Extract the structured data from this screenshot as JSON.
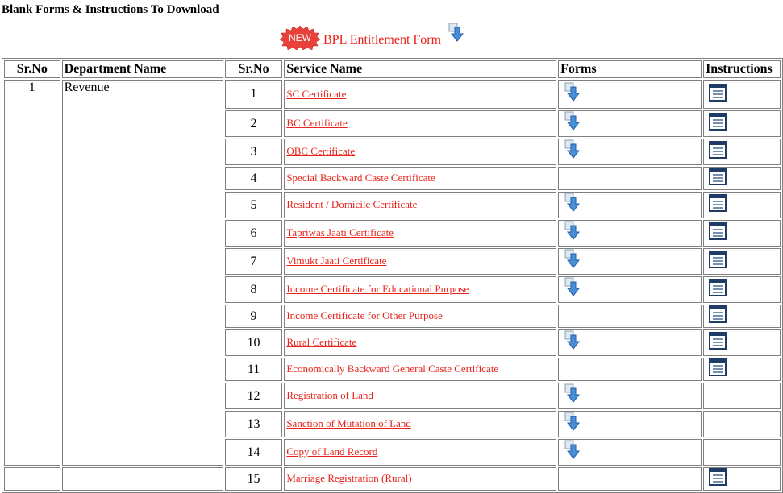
{
  "page": {
    "title": "Blank Forms & Instructions To Download"
  },
  "bpl": {
    "badge": "NEW",
    "link_label": "BPL Entitlement Form",
    "download_icon": "download-arrow-icon"
  },
  "table": {
    "headers": {
      "sr_no": "Sr.No",
      "department": "Department Name",
      "sr_no2": "Sr.No",
      "service": "Service Name",
      "forms": "Forms",
      "instructions": "Instructions"
    },
    "department": {
      "sr_no": "1",
      "name": "Revenue"
    },
    "rows": [
      {
        "sr": "1",
        "service": "SC Certificate",
        "linked": true,
        "form": true,
        "instr": true
      },
      {
        "sr": "2",
        "service": "BC Certificate",
        "linked": true,
        "form": true,
        "instr": true
      },
      {
        "sr": "3",
        "service": "OBC Certificate",
        "linked": true,
        "form": true,
        "instr": true
      },
      {
        "sr": "4",
        "service": "Special Backward Caste Certificate",
        "linked": false,
        "form": false,
        "instr": true
      },
      {
        "sr": "5",
        "service": "Resident / Domicile Certificate",
        "linked": true,
        "form": true,
        "instr": true
      },
      {
        "sr": "6",
        "service": "Tapriwas Jaati Certificate",
        "linked": true,
        "form": true,
        "instr": true
      },
      {
        "sr": "7",
        "service": "Vimukt Jaati Certificate",
        "linked": true,
        "form": true,
        "instr": true
      },
      {
        "sr": "8",
        "service": "Income Certificate for Educational Purpose",
        "linked": true,
        "form": true,
        "instr": true
      },
      {
        "sr": "9",
        "service": "Income Certificate for Other Purpose",
        "linked": false,
        "form": false,
        "instr": true
      },
      {
        "sr": "10",
        "service": "Rural Certificate",
        "linked": true,
        "form": true,
        "instr": true
      },
      {
        "sr": "11",
        "service": "Economically Backward General Caste Certificate",
        "linked": false,
        "form": false,
        "instr": true
      },
      {
        "sr": "12",
        "service": "Registration of Land",
        "linked": true,
        "form": true,
        "instr": false
      },
      {
        "sr": "13",
        "service": "Sanction of Mutation of Land",
        "linked": true,
        "form": true,
        "instr": false
      },
      {
        "sr": "14",
        "service": "Copy of Land Record",
        "linked": true,
        "form": true,
        "instr": false
      },
      {
        "sr": "15",
        "service": "Marriage Registration (Rural)",
        "linked": true,
        "form": false,
        "instr": true
      }
    ]
  }
}
